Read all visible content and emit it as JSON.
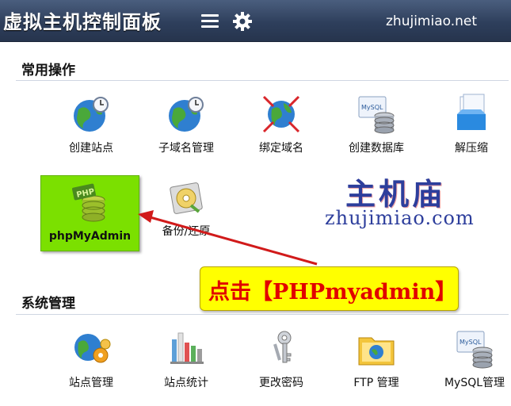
{
  "header": {
    "title": "虚拟主机控制面板",
    "site": "zhujimiao.net",
    "menu_icon": "hamburger-menu-icon",
    "settings_icon": "gear-icon"
  },
  "sections": {
    "common": {
      "title": "常用操作",
      "items": [
        {
          "label": "创建站点",
          "icon": "globe-clock-icon"
        },
        {
          "label": "子域名管理",
          "icon": "globe-clock-icon"
        },
        {
          "label": "绑定域名",
          "icon": "globe-arrows-icon"
        },
        {
          "label": "创建数据库",
          "icon": "mysql-database-icon"
        },
        {
          "label": "解压缩",
          "icon": "archive-icon"
        },
        {
          "label": "phpMyAdmin",
          "icon": "php-database-icon",
          "highlighted": true
        },
        {
          "label": "备份/还原",
          "icon": "backup-disk-icon"
        }
      ]
    },
    "system": {
      "title": "系统管理",
      "items": [
        {
          "label": "站点管理",
          "icon": "globe-gears-icon"
        },
        {
          "label": "站点统计",
          "icon": "bar-chart-icon"
        },
        {
          "label": "更改密码",
          "icon": "keys-icon"
        },
        {
          "label": "FTP 管理",
          "icon": "ftp-folder-icon"
        },
        {
          "label": "MySQL管理",
          "icon": "mysql-database-icon"
        }
      ]
    }
  },
  "watermark": {
    "logo_text": "主机庙",
    "url": "zhujimiao.com"
  },
  "callout": {
    "text": "点击【PHPmyadmin】"
  },
  "colors": {
    "header_bg": "#2e3f5c",
    "highlight_tile": "#7be000",
    "callout_bg": "#ffff00",
    "callout_text": "#e10000",
    "arrow": "#d11a1a",
    "watermark": "#2d3e9c"
  }
}
